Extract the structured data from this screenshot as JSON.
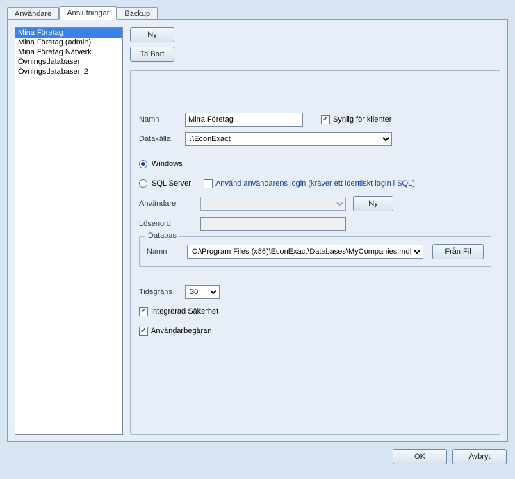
{
  "tabs": {
    "users": "Användare",
    "connections": "Anslutningar",
    "backup": "Backup"
  },
  "list": {
    "items": [
      "Mina Företag",
      "Mina Företag (admin)",
      "Mina Företag Nätverk",
      "Övningsdatabasen",
      "Övningsdatabasen 2"
    ]
  },
  "toolbar": {
    "new": "Ny",
    "delete": "Ta Bort"
  },
  "form": {
    "name_label": "Namn",
    "name_value": "Mina Företag",
    "visible_label": "Synlig för klienter",
    "datasource_label": "Datakälla",
    "datasource_value": ".\\EconExact",
    "auth_windows": "Windows",
    "auth_sql": "SQL Server",
    "use_user_login": "Använd användarens login (kräver ett identiskt login i SQL)",
    "user_label": "Användare",
    "user_new": "Ny",
    "password_label": "Lösenord",
    "database_legend": "Databas",
    "db_name_label": "Namn",
    "db_name_value": "C:\\Program Files (x86)\\EconExact\\Databases\\MyCompanies.mdf",
    "from_file": "Från Fil",
    "timeout_label": "Tidsgräns",
    "timeout_value": "30",
    "integrated_security": "Integrerad Säkerhet",
    "user_request": "Användarbegäran"
  },
  "actions": {
    "ok": "OK",
    "cancel": "Avbryt"
  }
}
